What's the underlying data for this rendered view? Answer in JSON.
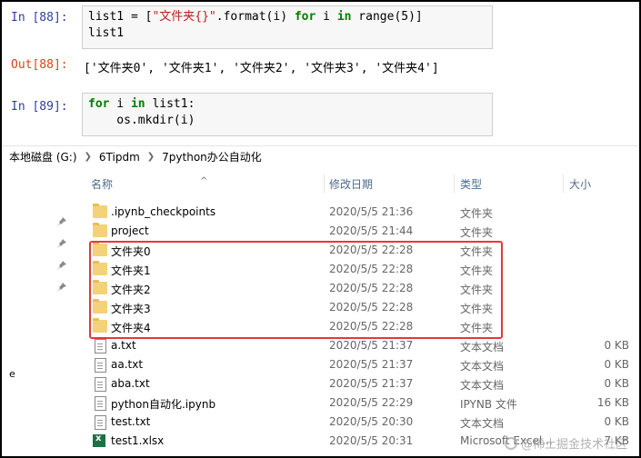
{
  "notebook": {
    "cell88": {
      "in_prompt": "In  [88]:",
      "code_line1_a": "list1 = [",
      "code_line1_str": "\"文件夹{}\"",
      "code_line1_b": ".format(i) ",
      "code_line1_kw1": "for",
      "code_line1_c": " i ",
      "code_line1_kw2": "in",
      "code_line1_d": " range(5)]",
      "code_line2": "list1",
      "out_prompt": "Out[88]:",
      "output": "['文件夹0', '文件夹1', '文件夹2', '文件夹3', '文件夹4']"
    },
    "cell89": {
      "in_prompt": "In  [89]:",
      "code_line1_kw1": "for",
      "code_line1_b": " i ",
      "code_line1_kw2": "in",
      "code_line1_c": " list1:",
      "code_line2": "    os.mkdir(i)"
    }
  },
  "explorer": {
    "breadcrumb": [
      "本地磁盘 (G:)",
      "6Tipdm",
      "7python办公自动化"
    ],
    "columns": {
      "name": "名称",
      "date": "修改日期",
      "type": "类型",
      "size": "大小"
    },
    "files": [
      {
        "name": ".ipynb_checkpoints",
        "date": "2020/5/5 21:36",
        "type": "文件夹",
        "size": "",
        "icon": "folder-icon"
      },
      {
        "name": "project",
        "date": "2020/5/5 21:44",
        "type": "文件夹",
        "size": "",
        "icon": "folder-icon"
      },
      {
        "name": "文件夹0",
        "date": "2020/5/5 22:28",
        "type": "文件夹",
        "size": "",
        "icon": "folder-icon"
      },
      {
        "name": "文件夹1",
        "date": "2020/5/5 22:28",
        "type": "文件夹",
        "size": "",
        "icon": "folder-icon"
      },
      {
        "name": "文件夹2",
        "date": "2020/5/5 22:28",
        "type": "文件夹",
        "size": "",
        "icon": "folder-icon"
      },
      {
        "name": "文件夹3",
        "date": "2020/5/5 22:28",
        "type": "文件夹",
        "size": "",
        "icon": "folder-icon"
      },
      {
        "name": "文件夹4",
        "date": "2020/5/5 22:28",
        "type": "文件夹",
        "size": "",
        "icon": "folder-icon"
      },
      {
        "name": "a.txt",
        "date": "2020/5/5 21:37",
        "type": "文本文档",
        "size": "0 KB",
        "icon": "text-file-icon"
      },
      {
        "name": "aa.txt",
        "date": "2020/5/5 21:37",
        "type": "文本文档",
        "size": "0 KB",
        "icon": "text-file-icon"
      },
      {
        "name": "aba.txt",
        "date": "2020/5/5 21:37",
        "type": "文本文档",
        "size": "0 KB",
        "icon": "text-file-icon"
      },
      {
        "name": "python自动化.ipynb",
        "date": "2020/5/5 22:29",
        "type": "IPYNB 文件",
        "size": "16 KB",
        "icon": "notebook-file-icon"
      },
      {
        "name": "test.txt",
        "date": "2020/5/5 20:30",
        "type": "文本文档",
        "size": "0 KB",
        "icon": "text-file-icon"
      },
      {
        "name": "test1.xlsx",
        "date": "2020/5/5 20:31",
        "type": "Microsoft Excel...",
        "size": "7 KB",
        "icon": "excel-file-icon"
      }
    ],
    "stray_letter": "e",
    "watermark": "@稀土掘金技术社区"
  },
  "colors": {
    "highlight": "#e53935",
    "in_prompt": "#303f9f",
    "out_prompt": "#d84315"
  }
}
